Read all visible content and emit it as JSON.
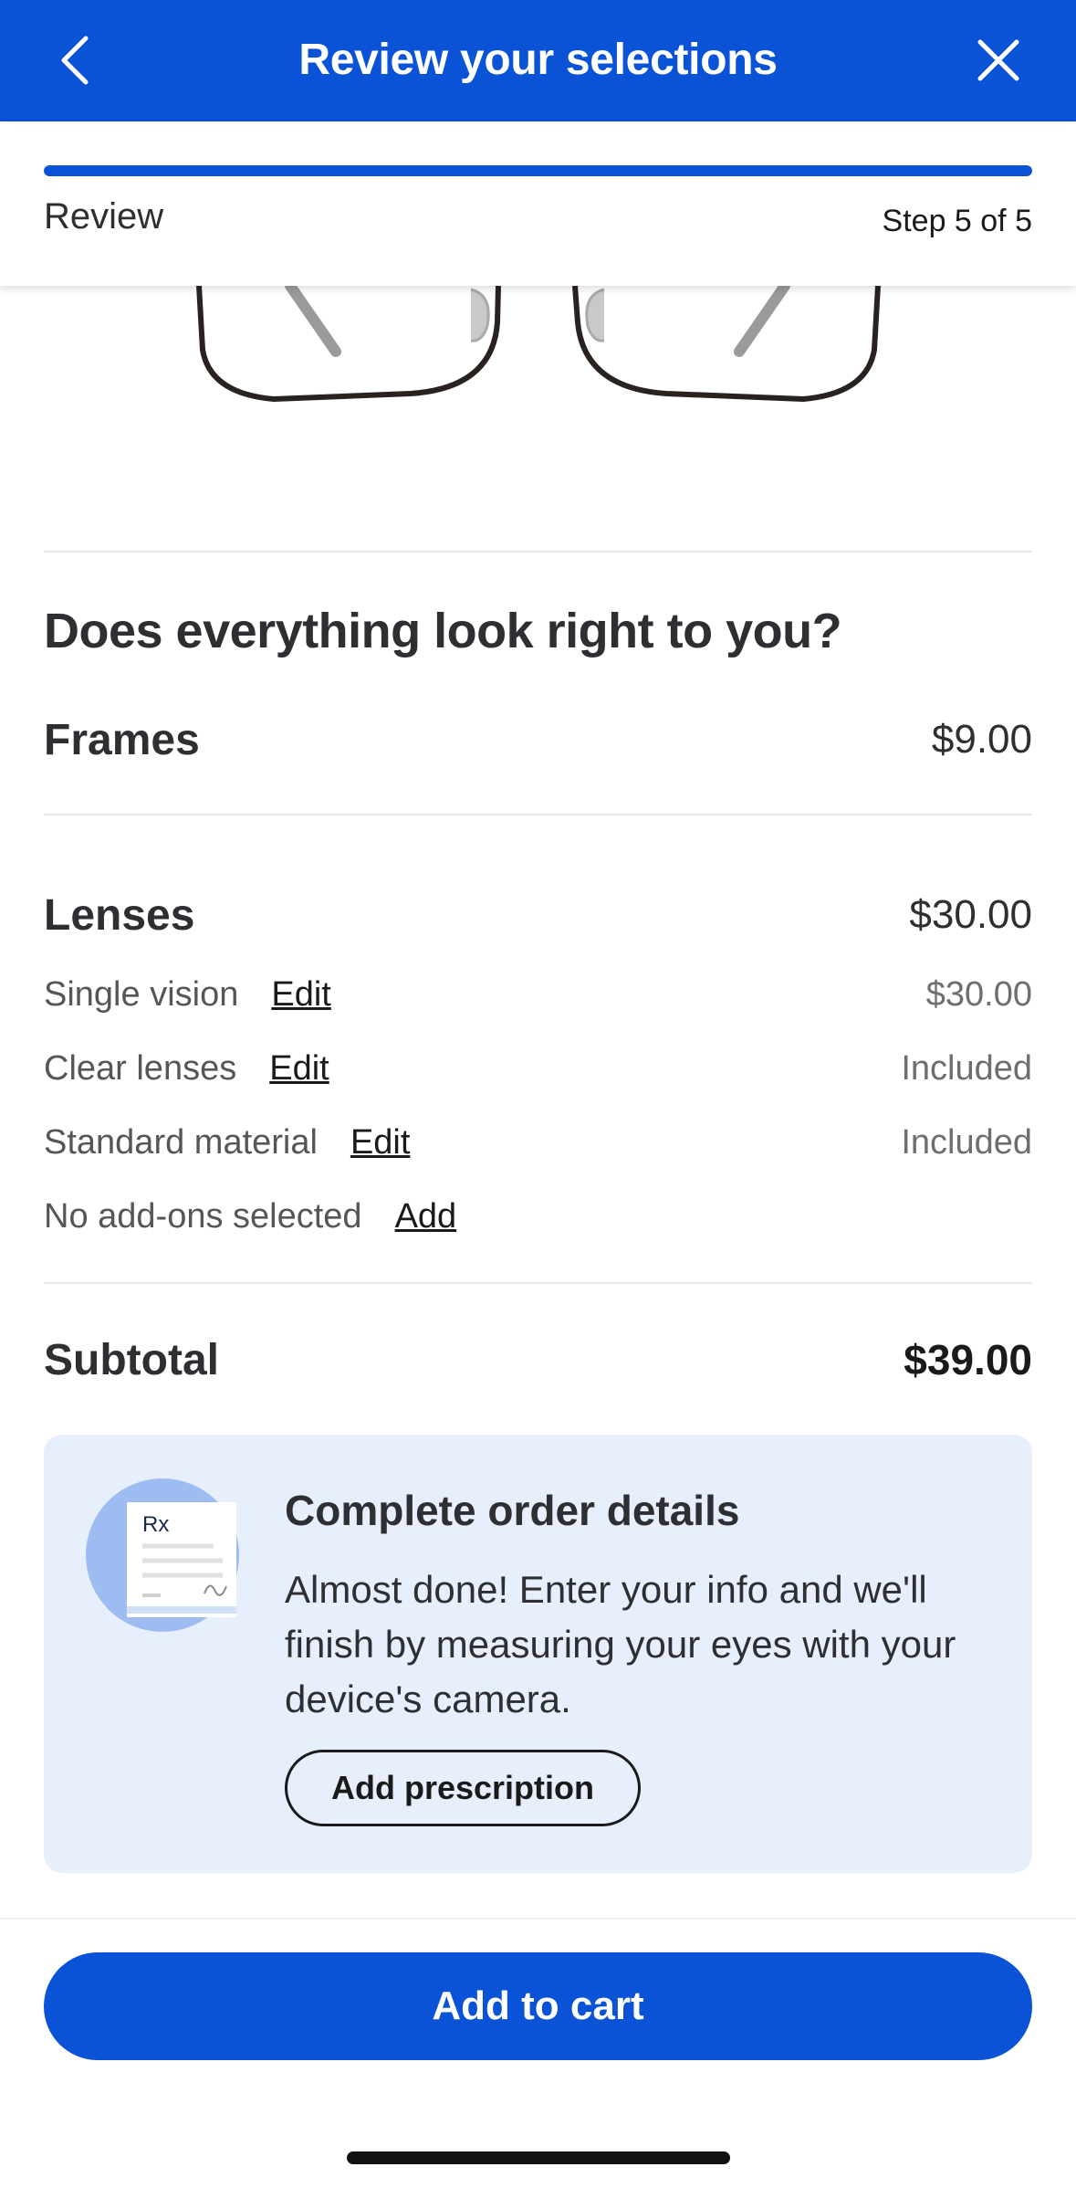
{
  "header": {
    "title": "Review your selections",
    "back_icon": "chevron-left-icon",
    "close_icon": "close-icon"
  },
  "progress": {
    "label": "Review",
    "step_text": "Step 5 of 5",
    "fraction": 1.0
  },
  "review": {
    "question": "Does everything look right to you?",
    "frames": {
      "label": "Frames",
      "price": "$9.00"
    },
    "lenses": {
      "label": "Lenses",
      "price": "$30.00",
      "items": [
        {
          "label": "Single vision",
          "action": "Edit",
          "value": "$30.00"
        },
        {
          "label": "Clear lenses",
          "action": "Edit",
          "value": "Included"
        },
        {
          "label": "Standard material",
          "action": "Edit",
          "value": "Included"
        },
        {
          "label": "No add-ons selected",
          "action": "Add",
          "value": ""
        }
      ]
    },
    "subtotal": {
      "label": "Subtotal",
      "value": "$39.00"
    }
  },
  "card": {
    "icon_text": "Rx",
    "title": "Complete order details",
    "body": "Almost done! Enter your info and we'll finish by measuring your eyes with your device's camera.",
    "button": "Add prescription"
  },
  "footer": {
    "button": "Add to cart"
  },
  "colors": {
    "brand_blue": "#0a52d6",
    "card_bg": "#e7effd"
  }
}
